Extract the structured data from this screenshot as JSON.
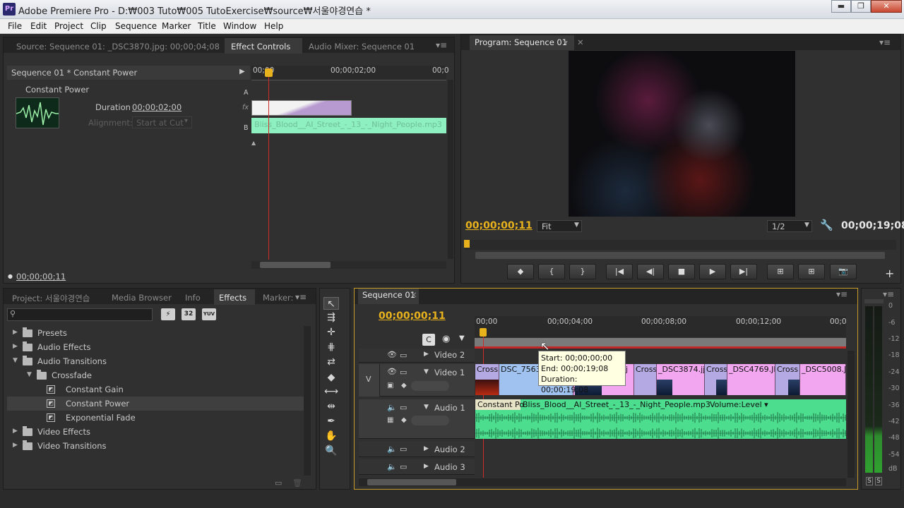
{
  "window": {
    "title": "Adobe Premiere Pro - D:₩003 Tuto₩005 TutoExercise₩source₩서울야경연습 *",
    "app_icon": "Pr",
    "min": "▬",
    "max": "❐",
    "close": "✕"
  },
  "menu": [
    "File",
    "Edit",
    "Project",
    "Clip",
    "Sequence",
    "Marker",
    "Title",
    "Window",
    "Help"
  ],
  "source_panel": {
    "tabs": [
      "Source: Sequence 01: _DSC3870.jpg: 00;00;04;08",
      "Effect Controls",
      "Audio Mixer: Sequence 01"
    ],
    "header": "Sequence 01 * Constant Power",
    "effect_name": "Constant Power",
    "duration_label": "Duration",
    "duration_value": "00;00;02;00",
    "alignment_label": "Alignment:",
    "alignment_value": "Start at Cut",
    "ruler_start": "00;00",
    "ruler_mid": "00;00;02;00",
    "ruler_end": "00;0",
    "track_a": "A",
    "track_b": "B",
    "fx": "fx",
    "clip_b_label": "Bliss_Blood__Al_Street_-_13_-_Night_People.mp3",
    "current_time": "00;00;00;11"
  },
  "program_panel": {
    "tab": "Program: Sequence 01",
    "timecode": "00;00;00;11",
    "fit": "Fit",
    "quality": "1/2",
    "duration": "00;00;19;08",
    "transport": [
      "◆",
      "{",
      "}",
      "|◀",
      "◀|",
      "■",
      "▶",
      "▶|",
      "⊞",
      "⊞",
      "📷"
    ],
    "add": "+"
  },
  "project_panel": {
    "tabs": [
      "Project: 서울야경연습",
      "Media Browser",
      "Info",
      "Effects",
      "Marker:"
    ],
    "search_placeholder": "",
    "btn_32": "32",
    "btn_yuv": "YUV",
    "tree": [
      {
        "label": "Presets",
        "type": "folder",
        "indent": 0,
        "expanded": false
      },
      {
        "label": "Audio Effects",
        "type": "folder",
        "indent": 0,
        "expanded": false
      },
      {
        "label": "Audio Transitions",
        "type": "folder",
        "indent": 0,
        "expanded": true
      },
      {
        "label": "Crossfade",
        "type": "folder",
        "indent": 1,
        "expanded": true
      },
      {
        "label": "Constant Gain",
        "type": "effect",
        "indent": 2
      },
      {
        "label": "Constant Power",
        "type": "effect",
        "indent": 2,
        "selected": true
      },
      {
        "label": "Exponential Fade",
        "type": "effect",
        "indent": 2
      },
      {
        "label": "Video Effects",
        "type": "folder",
        "indent": 0,
        "expanded": false
      },
      {
        "label": "Video Transitions",
        "type": "folder",
        "indent": 0,
        "expanded": false
      }
    ]
  },
  "timeline": {
    "tab": "Sequence 01",
    "timecode": "00;00;00;11",
    "ruler": [
      "00;00",
      "00;00;04;00",
      "00;00;08;00",
      "00;00;12;00",
      "00;0"
    ],
    "tracks": {
      "video2": "Video 2",
      "video1": "Video 1",
      "audio1": "Audio 1",
      "audio2": "Audio 2",
      "audio3": "Audio 3",
      "v": "V"
    },
    "video_clips": [
      "Cross",
      "DSC_7563.",
      "j",
      "Cross",
      "_DSC3874.jj",
      "Cross",
      "_DSC4769.JI",
      "Cross",
      "_DSC5008.JI"
    ],
    "audio_transition": "Constant Po",
    "audio_clip": "Bliss_Blood__Al_Street_-_13_-_Night_People.mp3",
    "volume": "Volume:Level ▾",
    "tooltip": {
      "start": "Start: 00;00;00;00",
      "end": "End: 00;00;19;08",
      "duration": "Duration: 00;00;19;08"
    }
  },
  "meter": {
    "labels": [
      "0",
      "-6",
      "-12",
      "-18",
      "-24",
      "-30",
      "-36",
      "-42",
      "-48",
      "-54",
      "dB"
    ],
    "solo": [
      "S",
      "S"
    ]
  }
}
